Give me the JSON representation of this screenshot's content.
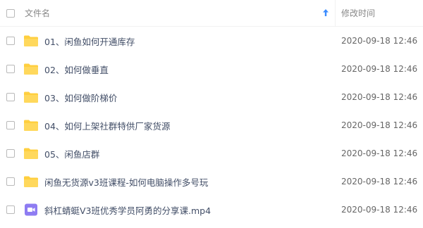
{
  "header": {
    "name_label": "文件名",
    "time_label": "修改时间",
    "sort_icon": "sort-ascending-arrow-icon",
    "accent_color": "#3b8cff"
  },
  "files": [
    {
      "name": "01、闲鱼如何开通库存",
      "modified": "2020-09-18 12:46",
      "type": "folder"
    },
    {
      "name": "02、如何做垂直",
      "modified": "2020-09-18 12:46",
      "type": "folder"
    },
    {
      "name": "03、如何做阶梯价",
      "modified": "2020-09-18 12:46",
      "type": "folder"
    },
    {
      "name": "04、如何上架社群特供厂家货源",
      "modified": "2020-09-18 12:46",
      "type": "folder"
    },
    {
      "name": "05、闲鱼店群",
      "modified": "2020-09-18 12:46",
      "type": "folder"
    },
    {
      "name": "闲鱼无货源v3班课程-如何电脑操作多号玩",
      "modified": "2020-09-18 12:46",
      "type": "folder"
    },
    {
      "name": "斜杠蜻蜓V3班优秀学员阿勇的分享课.mp4",
      "modified": "2020-09-18 12:46",
      "type": "video"
    }
  ],
  "colors": {
    "folder": "#ffcf3f",
    "video": "#8e7cf2"
  }
}
